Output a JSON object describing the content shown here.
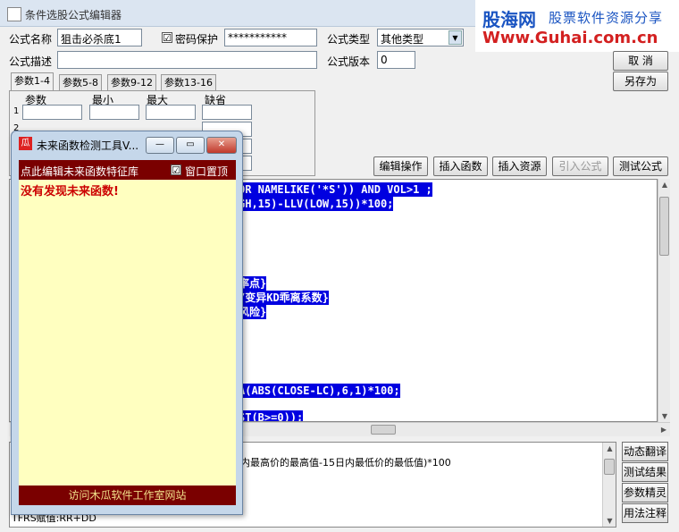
{
  "window": {
    "title": "条件选股公式编辑器"
  },
  "form": {
    "name_label": "公式名称",
    "name_value": "狙击必杀底1",
    "password_checkbox": "☑",
    "password_label": "密码保护",
    "password_value": "***********",
    "type_label": "公式类型",
    "type_value": "其他类型",
    "desc_label": "公式描述",
    "desc_value": "",
    "version_label": "公式版本",
    "version_value": "0"
  },
  "buttons": {
    "cancel": "取  消",
    "save_as": "另存为",
    "edit_op": "编辑操作",
    "insert_func": "插入函数",
    "insert_res": "插入资源",
    "import_formula": "引入公式",
    "test_formula": "测试公式"
  },
  "tabs": [
    "参数1-4",
    "参数5-8",
    "参数9-12",
    "参数13-16"
  ],
  "params_table": {
    "headers": [
      "参数",
      "最小",
      "最大",
      "缺省"
    ],
    "row_numbers": [
      "1",
      "2"
    ]
  },
  "code_lines": [
    "OR NAMELIKE('*S')) AND VOL>1 ;",
    "GH,15)-LLV(LOW,15))*100;",
    "率点}",
    "/变异KD乖离系数}",
    "风险}",
    "A(ABS(CLOSE-LC),6,1)*100;",
    "ST(B>=0));"
  ],
  "bottom": {
    "desc_text": "内最高价的最高值-15日内最低价的最低值)*100",
    "last_line": "TFRS赋值:RR+DD"
  },
  "side_buttons": [
    "动态翻译",
    "测试结果",
    "参数精灵",
    "用法注释"
  ],
  "popup": {
    "icon": "瓜",
    "title": "未来函数检测工具V...",
    "minimize": "—",
    "restore": "▭",
    "close": "✕",
    "edit_link": "点此编辑未来函数特征库",
    "topmost_check": "☑",
    "topmost_label": "窗口置顶",
    "result": "没有发现未来函数!",
    "footer_link": "访问木瓜软件工作室网站"
  },
  "watermark": {
    "brand": "股海网",
    "slogan": "股票软件资源分享",
    "url": "Www.Guhai.com.cn"
  },
  "colors": {
    "code_highlight": "#0000e0",
    "popup_bar": "#7a0000",
    "popup_body": "#ffffc0",
    "result_text": "#cc0000"
  }
}
